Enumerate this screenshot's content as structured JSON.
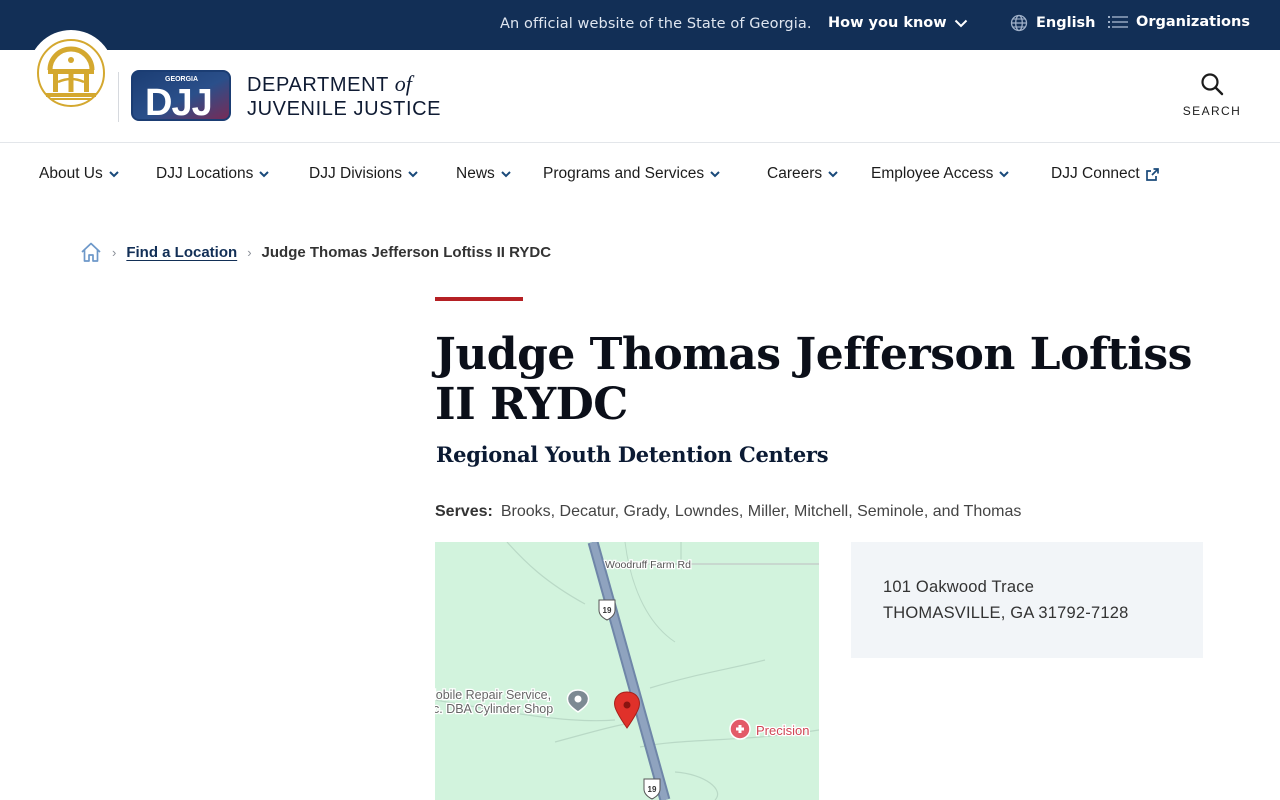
{
  "banner": {
    "official_text": "An official website of the State of Georgia.",
    "how_you_know": "How you know",
    "language": "English",
    "organizations": "Organizations"
  },
  "header": {
    "djj_logo_state": "GEORGIA",
    "djj_logo_text": "DJJ",
    "dept_line1_a": "DEPARTMENT",
    "dept_line1_b": "of",
    "dept_line2": "JUVENILE JUSTICE",
    "search_label": "SEARCH"
  },
  "nav": {
    "items": [
      {
        "label": "About Us",
        "icon": "chevron-down-icon"
      },
      {
        "label": "DJJ Locations",
        "icon": "chevron-down-icon"
      },
      {
        "label": "DJJ Divisions",
        "icon": "chevron-down-icon"
      },
      {
        "label": "News",
        "icon": "chevron-down-icon"
      },
      {
        "label": "Programs and Services",
        "icon": "chevron-down-icon"
      },
      {
        "label": "Careers",
        "icon": "chevron-down-icon"
      },
      {
        "label": "Employee Access",
        "icon": "chevron-down-icon"
      },
      {
        "label": "DJJ Connect",
        "icon": "external-link-icon"
      }
    ]
  },
  "breadcrumb": {
    "home_icon": "home-icon",
    "link": "Find a Location",
    "current": "Judge Thomas Jefferson Loftiss II RYDC"
  },
  "page": {
    "title": "Judge Thomas Jefferson Loftiss II RYDC",
    "subtitle": "Regional Youth Detention Centers",
    "serves_label": "Serves:",
    "serves_value": "Brooks, Decatur, Grady, Lowndes, Miller, Mitchell, Seminole, and Thomas",
    "address_line1": "101 Oakwood Trace",
    "address_line2": "THOMASVILLE, GA 31792-7128"
  },
  "map": {
    "road_label": "Woodruff Farm Rd",
    "highway_shield": "19",
    "poi1_line1": "lobile Repair Service,",
    "poi1_line2": "c. DBA Cylinder Shop",
    "poi2": "Precision"
  },
  "colors": {
    "banner_bg": "#122f56",
    "accent_red": "#b52024",
    "address_bg": "#f2f5f8",
    "map_bg": "#d2f3dd"
  }
}
